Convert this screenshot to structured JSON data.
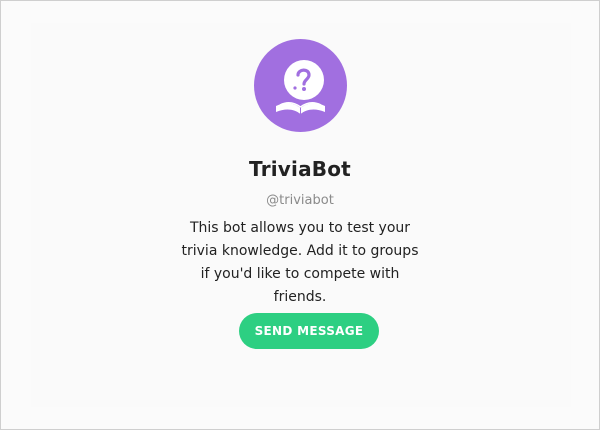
{
  "bot": {
    "name": "TriviaBot",
    "username": "@triviabot",
    "description": "This bot allows you to test your trivia knowledge. Add it to groups if you'd like to compete with friends.",
    "avatar_icon": "book-question-icon"
  },
  "actions": {
    "send_label": "SEND MESSAGE"
  },
  "colors": {
    "avatar_bg": "#a16fe0",
    "button_bg": "#2dcf82"
  }
}
